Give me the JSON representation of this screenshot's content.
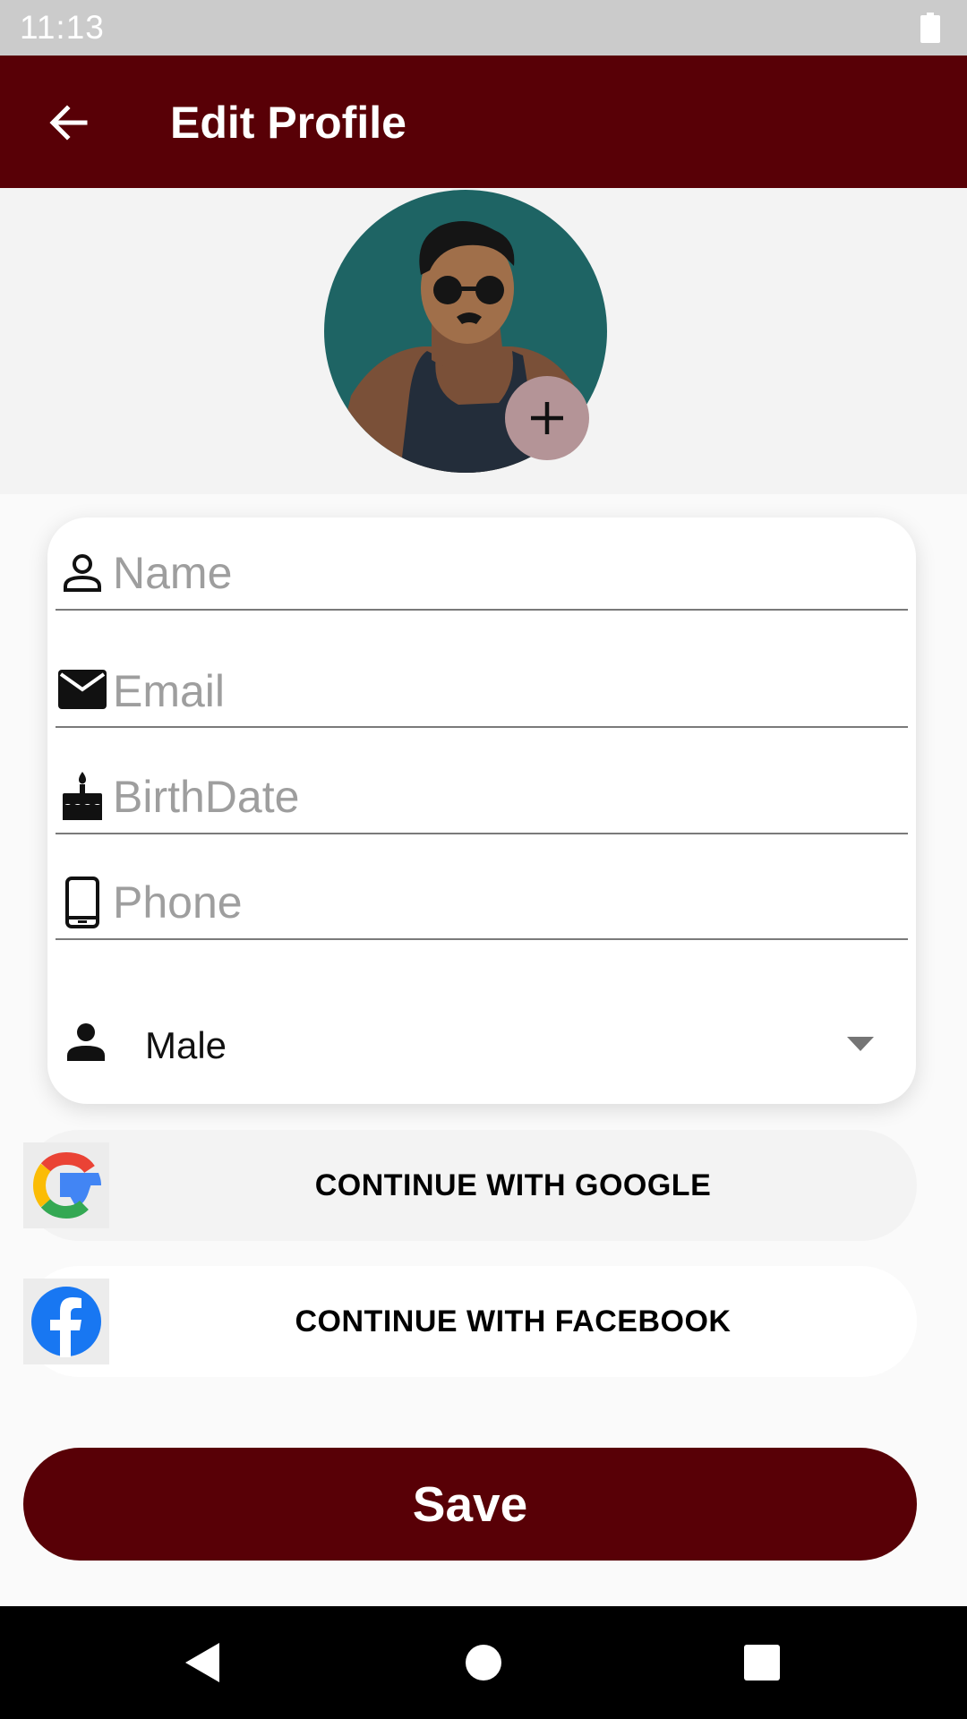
{
  "status_bar": {
    "time": "11:13"
  },
  "app_bar": {
    "title": "Edit Profile"
  },
  "form": {
    "name_placeholder": "Name",
    "email_placeholder": "Email",
    "birthdate_placeholder": "BirthDate",
    "phone_placeholder": "Phone",
    "gender_value": "Male"
  },
  "social": {
    "google_label": "CONTINUE WITH GOOGLE",
    "facebook_label": "CONTINUE WITH FACEBOOK"
  },
  "actions": {
    "save_label": "Save"
  },
  "colors": {
    "primary": "#580006",
    "status_bar": "#cbcbcb",
    "avatar_bg": "#1e6464",
    "add_button": "#b49497"
  },
  "icons": {
    "back": "arrow-left-icon",
    "add_photo": "plus-icon",
    "name": "person-outline-icon",
    "email": "mail-icon",
    "birthdate": "cake-icon",
    "phone": "phone-icon",
    "gender": "person-icon",
    "dropdown": "caret-down-icon",
    "google": "google-logo",
    "facebook": "facebook-logo",
    "nav_back": "triangle-back-icon",
    "nav_home": "circle-home-icon",
    "nav_recents": "square-recents-icon"
  }
}
